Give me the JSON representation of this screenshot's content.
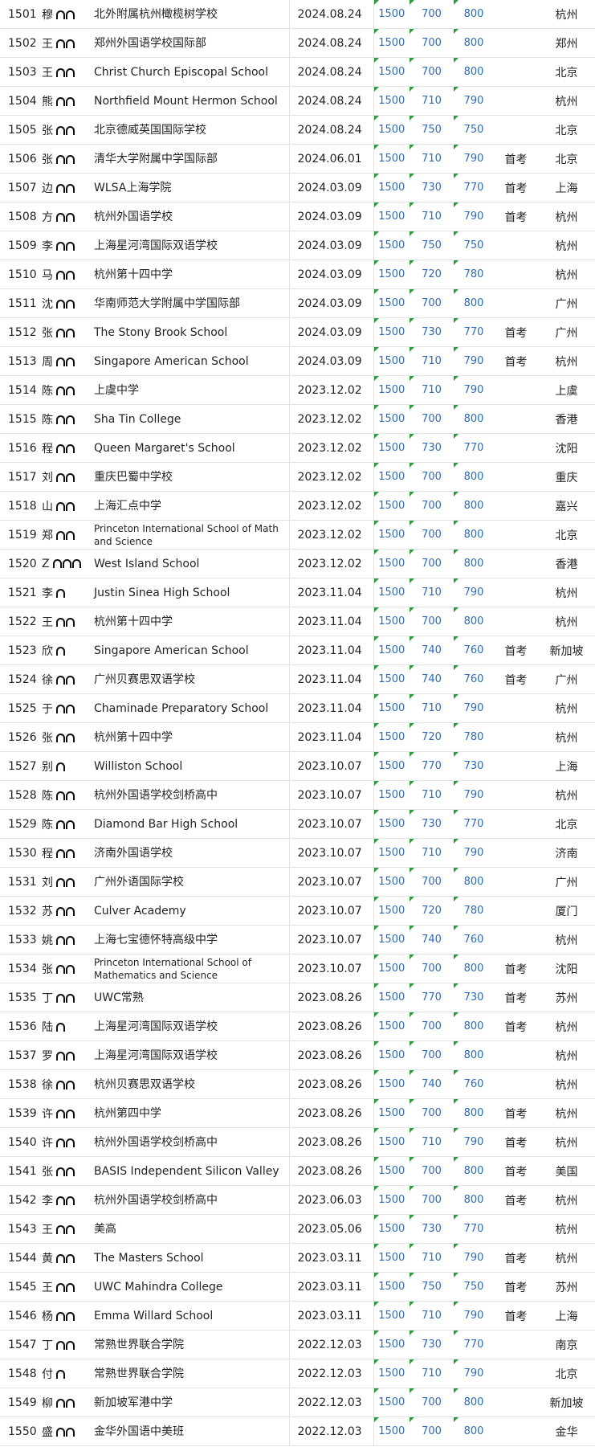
{
  "rows": [
    {
      "num": "1501",
      "surname": "穆",
      "marks": 2,
      "school": "北外附属杭州橄榄树学校",
      "date": "2024.08.24",
      "total": "1500",
      "s1": "700",
      "s2": "800",
      "first": "",
      "city": "杭州"
    },
    {
      "num": "1502",
      "surname": "王",
      "marks": 2,
      "school": "郑州外国语学校国际部",
      "date": "2024.08.24",
      "total": "1500",
      "s1": "700",
      "s2": "800",
      "first": "",
      "city": "郑州"
    },
    {
      "num": "1503",
      "surname": "王",
      "marks": 2,
      "school": "Christ Church Episcopal School",
      "date": "2024.08.24",
      "total": "1500",
      "s1": "700",
      "s2": "800",
      "first": "",
      "city": "北京"
    },
    {
      "num": "1504",
      "surname": "熊",
      "marks": 2,
      "school": "Northfield Mount Hermon School",
      "date": "2024.08.24",
      "total": "1500",
      "s1": "710",
      "s2": "790",
      "first": "",
      "city": "杭州"
    },
    {
      "num": "1505",
      "surname": "张",
      "marks": 2,
      "school": "北京德威英国国际学校",
      "date": "2024.08.24",
      "total": "1500",
      "s1": "750",
      "s2": "750",
      "first": "",
      "city": "北京"
    },
    {
      "num": "1506",
      "surname": "张",
      "marks": 2,
      "school": "清华大学附属中学国际部",
      "date": "2024.06.01",
      "total": "1500",
      "s1": "710",
      "s2": "790",
      "first": "首考",
      "city": "北京"
    },
    {
      "num": "1507",
      "surname": "边",
      "marks": 2,
      "school": "WLSA上海学院",
      "date": "2024.03.09",
      "total": "1500",
      "s1": "730",
      "s2": "770",
      "first": "首考",
      "city": "上海"
    },
    {
      "num": "1508",
      "surname": "方",
      "marks": 2,
      "school": "杭州外国语学校",
      "date": "2024.03.09",
      "total": "1500",
      "s1": "710",
      "s2": "790",
      "first": "首考",
      "city": "杭州"
    },
    {
      "num": "1509",
      "surname": "李",
      "marks": 2,
      "school": "上海星河湾国际双语学校",
      "date": "2024.03.09",
      "total": "1500",
      "s1": "750",
      "s2": "750",
      "first": "",
      "city": "杭州"
    },
    {
      "num": "1510",
      "surname": "马",
      "marks": 2,
      "school": "杭州第十四中学",
      "date": "2024.03.09",
      "total": "1500",
      "s1": "720",
      "s2": "780",
      "first": "",
      "city": "杭州"
    },
    {
      "num": "1511",
      "surname": "沈",
      "marks": 2,
      "school": "华南师范大学附属中学国际部",
      "date": "2024.03.09",
      "total": "1500",
      "s1": "700",
      "s2": "800",
      "first": "",
      "city": "广州"
    },
    {
      "num": "1512",
      "surname": "张",
      "marks": 2,
      "school": "The Stony Brook School",
      "date": "2024.03.09",
      "total": "1500",
      "s1": "730",
      "s2": "770",
      "first": "首考",
      "city": "广州"
    },
    {
      "num": "1513",
      "surname": "周",
      "marks": 2,
      "school": "Singapore American School",
      "date": "2024.03.09",
      "total": "1500",
      "s1": "710",
      "s2": "790",
      "first": "首考",
      "city": "杭州"
    },
    {
      "num": "1514",
      "surname": "陈",
      "marks": 2,
      "school": "上虞中学",
      "date": "2023.12.02",
      "total": "1500",
      "s1": "710",
      "s2": "790",
      "first": "",
      "city": "上虞"
    },
    {
      "num": "1515",
      "surname": "陈",
      "marks": 2,
      "school": "Sha Tin College",
      "date": "2023.12.02",
      "total": "1500",
      "s1": "700",
      "s2": "800",
      "first": "",
      "city": "香港"
    },
    {
      "num": "1516",
      "surname": "程",
      "marks": 2,
      "school": "Queen Margaret's School",
      "date": "2023.12.02",
      "total": "1500",
      "s1": "730",
      "s2": "770",
      "first": "",
      "city": "沈阳"
    },
    {
      "num": "1517",
      "surname": "刘",
      "marks": 2,
      "school": "重庆巴蜀中学校",
      "date": "2023.12.02",
      "total": "1500",
      "s1": "700",
      "s2": "800",
      "first": "",
      "city": "重庆"
    },
    {
      "num": "1518",
      "surname": "山",
      "marks": 2,
      "school": "上海汇点中学",
      "date": "2023.12.02",
      "total": "1500",
      "s1": "700",
      "s2": "800",
      "first": "",
      "city": "嘉兴"
    },
    {
      "num": "1519",
      "surname": "郑",
      "marks": 2,
      "school": "Princeton International School of Math and Science",
      "date": "2023.12.02",
      "total": "1500",
      "s1": "700",
      "s2": "800",
      "first": "",
      "city": "北京"
    },
    {
      "num": "1520",
      "surname": "Z",
      "marks": 3,
      "school": "West Island School",
      "date": "2023.12.02",
      "total": "1500",
      "s1": "700",
      "s2": "800",
      "first": "",
      "city": "香港"
    },
    {
      "num": "1521",
      "surname": "李",
      "marks": 1,
      "school": "Justin Sinea High School",
      "date": "2023.11.04",
      "total": "1500",
      "s1": "710",
      "s2": "790",
      "first": "",
      "city": "杭州"
    },
    {
      "num": "1522",
      "surname": "王",
      "marks": 2,
      "school": "杭州第十四中学",
      "date": "2023.11.04",
      "total": "1500",
      "s1": "700",
      "s2": "800",
      "first": "",
      "city": "杭州"
    },
    {
      "num": "1523",
      "surname": "欣",
      "marks": 1,
      "school": "Singapore American School",
      "date": "2023.11.04",
      "total": "1500",
      "s1": "740",
      "s2": "760",
      "first": "首考",
      "city": "新加坡"
    },
    {
      "num": "1524",
      "surname": "徐",
      "marks": 2,
      "school": "广州贝赛思双语学校",
      "date": "2023.11.04",
      "total": "1500",
      "s1": "740",
      "s2": "760",
      "first": "首考",
      "city": "广州"
    },
    {
      "num": "1525",
      "surname": "于",
      "marks": 2,
      "school": "Chaminade Preparatory School",
      "date": "2023.11.04",
      "total": "1500",
      "s1": "710",
      "s2": "790",
      "first": "",
      "city": "杭州"
    },
    {
      "num": "1526",
      "surname": "张",
      "marks": 2,
      "school": "杭州第十四中学",
      "date": "2023.11.04",
      "total": "1500",
      "s1": "720",
      "s2": "780",
      "first": "",
      "city": "杭州"
    },
    {
      "num": "1527",
      "surname": "别",
      "marks": 1,
      "school": "Williston School",
      "date": "2023.10.07",
      "total": "1500",
      "s1": "770",
      "s2": "730",
      "first": "",
      "city": "上海"
    },
    {
      "num": "1528",
      "surname": "陈",
      "marks": 2,
      "school": "杭州外国语学校剑桥高中",
      "date": "2023.10.07",
      "total": "1500",
      "s1": "710",
      "s2": "790",
      "first": "",
      "city": "杭州"
    },
    {
      "num": "1529",
      "surname": "陈",
      "marks": 2,
      "school": "Diamond Bar High School",
      "date": "2023.10.07",
      "total": "1500",
      "s1": "730",
      "s2": "770",
      "first": "",
      "city": "北京"
    },
    {
      "num": "1530",
      "surname": "程",
      "marks": 2,
      "school": "济南外国语学校",
      "date": "2023.10.07",
      "total": "1500",
      "s1": "710",
      "s2": "790",
      "first": "",
      "city": "济南"
    },
    {
      "num": "1531",
      "surname": "刘",
      "marks": 2,
      "school": "广州外语国际学校",
      "date": "2023.10.07",
      "total": "1500",
      "s1": "700",
      "s2": "800",
      "first": "",
      "city": "广州"
    },
    {
      "num": "1532",
      "surname": "苏",
      "marks": 2,
      "school": "Culver Academy",
      "date": "2023.10.07",
      "total": "1500",
      "s1": "720",
      "s2": "780",
      "first": "",
      "city": "厦门"
    },
    {
      "num": "1533",
      "surname": "姚",
      "marks": 2,
      "school": "上海七宝德怀特高级中学",
      "date": "2023.10.07",
      "total": "1500",
      "s1": "740",
      "s2": "760",
      "first": "",
      "city": "杭州"
    },
    {
      "num": "1534",
      "surname": "张",
      "marks": 2,
      "school": "Princeton International School of Mathematics and Science",
      "date": "2023.10.07",
      "total": "1500",
      "s1": "700",
      "s2": "800",
      "first": "首考",
      "city": "沈阳"
    },
    {
      "num": "1535",
      "surname": "丁",
      "marks": 2,
      "school": "UWC常熟",
      "date": "2023.08.26",
      "total": "1500",
      "s1": "770",
      "s2": "730",
      "first": "首考",
      "city": "苏州"
    },
    {
      "num": "1536",
      "surname": "陆",
      "marks": 1,
      "school": "上海星河湾国际双语学校",
      "date": "2023.08.26",
      "total": "1500",
      "s1": "700",
      "s2": "800",
      "first": "首考",
      "city": "杭州"
    },
    {
      "num": "1537",
      "surname": "罗",
      "marks": 2,
      "school": "上海星河湾国际双语学校",
      "date": "2023.08.26",
      "total": "1500",
      "s1": "700",
      "s2": "800",
      "first": "",
      "city": "杭州"
    },
    {
      "num": "1538",
      "surname": "徐",
      "marks": 2,
      "school": "杭州贝赛思双语学校",
      "date": "2023.08.26",
      "total": "1500",
      "s1": "740",
      "s2": "760",
      "first": "",
      "city": "杭州"
    },
    {
      "num": "1539",
      "surname": "许",
      "marks": 2,
      "school": "杭州第四中学",
      "date": "2023.08.26",
      "total": "1500",
      "s1": "700",
      "s2": "800",
      "first": "首考",
      "city": "杭州"
    },
    {
      "num": "1540",
      "surname": "许",
      "marks": 2,
      "school": "杭州外国语学校剑桥高中",
      "date": "2023.08.26",
      "total": "1500",
      "s1": "710",
      "s2": "790",
      "first": "首考",
      "city": "杭州"
    },
    {
      "num": "1541",
      "surname": "张",
      "marks": 2,
      "school": "BASIS Independent Silicon Valley",
      "date": "2023.08.26",
      "total": "1500",
      "s1": "700",
      "s2": "800",
      "first": "首考",
      "city": "美国"
    },
    {
      "num": "1542",
      "surname": "李",
      "marks": 2,
      "school": "杭州外国语学校剑桥高中",
      "date": "2023.06.03",
      "total": "1500",
      "s1": "700",
      "s2": "800",
      "first": "首考",
      "city": "杭州"
    },
    {
      "num": "1543",
      "surname": "王",
      "marks": 2,
      "school": "美高",
      "date": "2023.05.06",
      "total": "1500",
      "s1": "730",
      "s2": "770",
      "first": "",
      "city": "杭州"
    },
    {
      "num": "1544",
      "surname": "黄",
      "marks": 2,
      "school": "The Masters School",
      "date": "2023.03.11",
      "total": "1500",
      "s1": "710",
      "s2": "790",
      "first": "首考",
      "city": "杭州"
    },
    {
      "num": "1545",
      "surname": "王",
      "marks": 2,
      "school": "UWC Mahindra College",
      "date": "2023.03.11",
      "total": "1500",
      "s1": "750",
      "s2": "750",
      "first": "首考",
      "city": "苏州"
    },
    {
      "num": "1546",
      "surname": "杨",
      "marks": 2,
      "school": "Emma Willard School",
      "date": "2023.03.11",
      "total": "1500",
      "s1": "710",
      "s2": "790",
      "first": "首考",
      "city": "上海"
    },
    {
      "num": "1547",
      "surname": "丁",
      "marks": 2,
      "school": "常熟世界联合学院",
      "date": "2022.12.03",
      "total": "1500",
      "s1": "730",
      "s2": "770",
      "first": "",
      "city": "南京"
    },
    {
      "num": "1548",
      "surname": "付",
      "marks": 1,
      "school": "常熟世界联合学院",
      "date": "2022.12.03",
      "total": "1500",
      "s1": "710",
      "s2": "790",
      "first": "",
      "city": "北京"
    },
    {
      "num": "1549",
      "surname": "柳",
      "marks": 2,
      "school": "新加坡军港中学",
      "date": "2022.12.03",
      "total": "1500",
      "s1": "700",
      "s2": "800",
      "first": "",
      "city": "新加坡"
    },
    {
      "num": "1550",
      "surname": "盛",
      "marks": 2,
      "school": "金华外国语中美班",
      "date": "2022.12.03",
      "total": "1500",
      "s1": "700",
      "s2": "800",
      "first": "",
      "city": "金华"
    }
  ]
}
